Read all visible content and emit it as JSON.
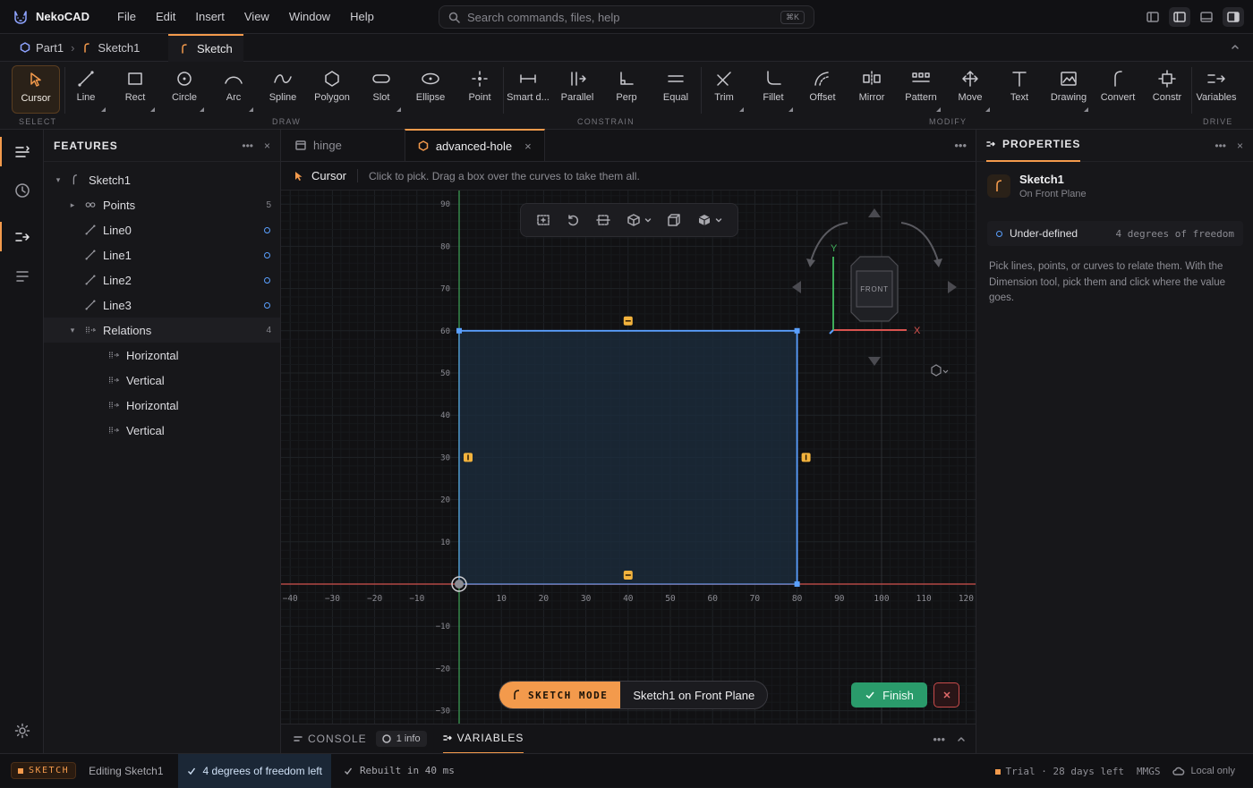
{
  "app": {
    "name": "NekoCAD"
  },
  "menu": [
    "File",
    "Edit",
    "Insert",
    "View",
    "Window",
    "Help"
  ],
  "search": {
    "placeholder": "Search commands, files, help",
    "shortcut": "⌘K"
  },
  "breadcrumb": {
    "part": "Part1",
    "sketch": "Sketch1"
  },
  "doc_tab": {
    "label": "Sketch"
  },
  "ribbon": {
    "groups": [
      {
        "label": "SELECT",
        "tools": [
          {
            "label": "Cursor",
            "icon": "cursor-icon",
            "active": true
          }
        ]
      },
      {
        "label": "DRAW",
        "tools": [
          {
            "label": "Line",
            "icon": "line-icon"
          },
          {
            "label": "Rect",
            "icon": "rect-icon"
          },
          {
            "label": "Circle",
            "icon": "circle-icon"
          },
          {
            "label": "Arc",
            "icon": "arc-icon"
          },
          {
            "label": "Spline",
            "icon": "spline-icon"
          },
          {
            "label": "Polygon",
            "icon": "polygon-icon"
          },
          {
            "label": "Slot",
            "icon": "slot-icon"
          },
          {
            "label": "Ellipse",
            "icon": "ellipse-icon"
          },
          {
            "label": "Point",
            "icon": "point-icon"
          }
        ]
      },
      {
        "label": "CONSTRAIN",
        "tools": [
          {
            "label": "Smart d...",
            "icon": "smart-dimension-icon"
          },
          {
            "label": "Parallel",
            "icon": "parallel-icon"
          },
          {
            "label": "Perp",
            "icon": "perpendicular-icon"
          },
          {
            "label": "Equal",
            "icon": "equal-icon"
          }
        ]
      },
      {
        "label": "MODIFY",
        "tools": [
          {
            "label": "Trim",
            "icon": "trim-icon"
          },
          {
            "label": "Fillet",
            "icon": "fillet-icon"
          },
          {
            "label": "Offset",
            "icon": "offset-icon"
          },
          {
            "label": "Mirror",
            "icon": "mirror-icon"
          },
          {
            "label": "Pattern",
            "icon": "pattern-icon"
          },
          {
            "label": "Move",
            "icon": "move-icon"
          },
          {
            "label": "Text",
            "icon": "text-icon"
          },
          {
            "label": "Drawing",
            "icon": "drawing-icon"
          },
          {
            "label": "Convert",
            "icon": "convert-icon"
          },
          {
            "label": "Constr",
            "icon": "construction-icon"
          }
        ]
      },
      {
        "label": "DRIVE",
        "tools": [
          {
            "label": "Variables",
            "icon": "variables-icon"
          }
        ]
      }
    ]
  },
  "features": {
    "title": "FEATURES",
    "tree": [
      {
        "label": "Sketch1",
        "icon": "sketch-icon",
        "depth": 0,
        "expanded": true
      },
      {
        "label": "Points",
        "icon": "points-icon",
        "depth": 1,
        "count": "5",
        "expander": true
      },
      {
        "label": "Line0",
        "icon": "line-icon",
        "depth": 1,
        "status": "under-defined"
      },
      {
        "label": "Line1",
        "icon": "line-icon",
        "depth": 1,
        "status": "under-defined"
      },
      {
        "label": "Line2",
        "icon": "line-icon",
        "depth": 1,
        "status": "under-defined"
      },
      {
        "label": "Line3",
        "icon": "line-icon",
        "depth": 1,
        "status": "under-defined"
      },
      {
        "label": "Relations",
        "icon": "relations-icon",
        "depth": 1,
        "count": "4",
        "expander": true,
        "expanded": true,
        "selected": true
      },
      {
        "label": "Horizontal",
        "icon": "relation-icon",
        "depth": 2
      },
      {
        "label": "Vertical",
        "icon": "relation-icon",
        "depth": 2
      },
      {
        "label": "Horizontal",
        "icon": "relation-icon",
        "depth": 2
      },
      {
        "label": "Vertical",
        "icon": "relation-icon",
        "depth": 2
      }
    ]
  },
  "editor_tabs": [
    {
      "label": "hinge",
      "active": false
    },
    {
      "label": "advanced-hole",
      "active": true
    }
  ],
  "hint": {
    "tool": "Cursor",
    "text": "Click to pick. Drag a box over the curves to take them all."
  },
  "viewport": {
    "x_ticks": [
      "−40",
      "−30",
      "−20",
      "−10",
      "10",
      "20",
      "30",
      "40",
      "50",
      "60",
      "70",
      "80",
      "90",
      "100",
      "110",
      "120"
    ],
    "y_ticks": [
      "90",
      "80",
      "70",
      "60",
      "50",
      "40",
      "30",
      "20",
      "10",
      "−10",
      "−20",
      "−30"
    ],
    "rectangle": {
      "x_min": 0,
      "x_max": 80,
      "y_min": 0,
      "y_max": 60
    },
    "view_cube": {
      "face": "FRONT",
      "x_axis": "X",
      "y_axis": "Y"
    },
    "sketch_mode": {
      "label": "SKETCH MODE",
      "plane": "Sketch1 on Front Plane"
    },
    "finish_label": "Finish"
  },
  "bottom_tabs": {
    "console": "CONSOLE",
    "console_badge": "1 info",
    "variables": "VARIABLES"
  },
  "properties": {
    "title": "PROPERTIES",
    "name": "Sketch1",
    "subtitle": "On Front Plane",
    "status_label": "Under-defined",
    "status_value": "4 degrees of freedom",
    "help": "Pick lines, points, or curves to relate them. With the Dimension tool, pick them and click where the value goes."
  },
  "statusbar": {
    "mode": "SKETCH",
    "editing": "Editing Sketch1",
    "dof": "4 degrees of freedom left",
    "rebuild": "Rebuilt in 40 ms",
    "trial": "Trial · 28 days left",
    "units": "MMGS",
    "storage": "Local only"
  },
  "colors": {
    "accent": "#f39a4c",
    "sketch_line": "#5aa0ff",
    "x_axis": "#d9534f",
    "y_axis": "#3fae5a",
    "finish": "#2a9b6b"
  }
}
